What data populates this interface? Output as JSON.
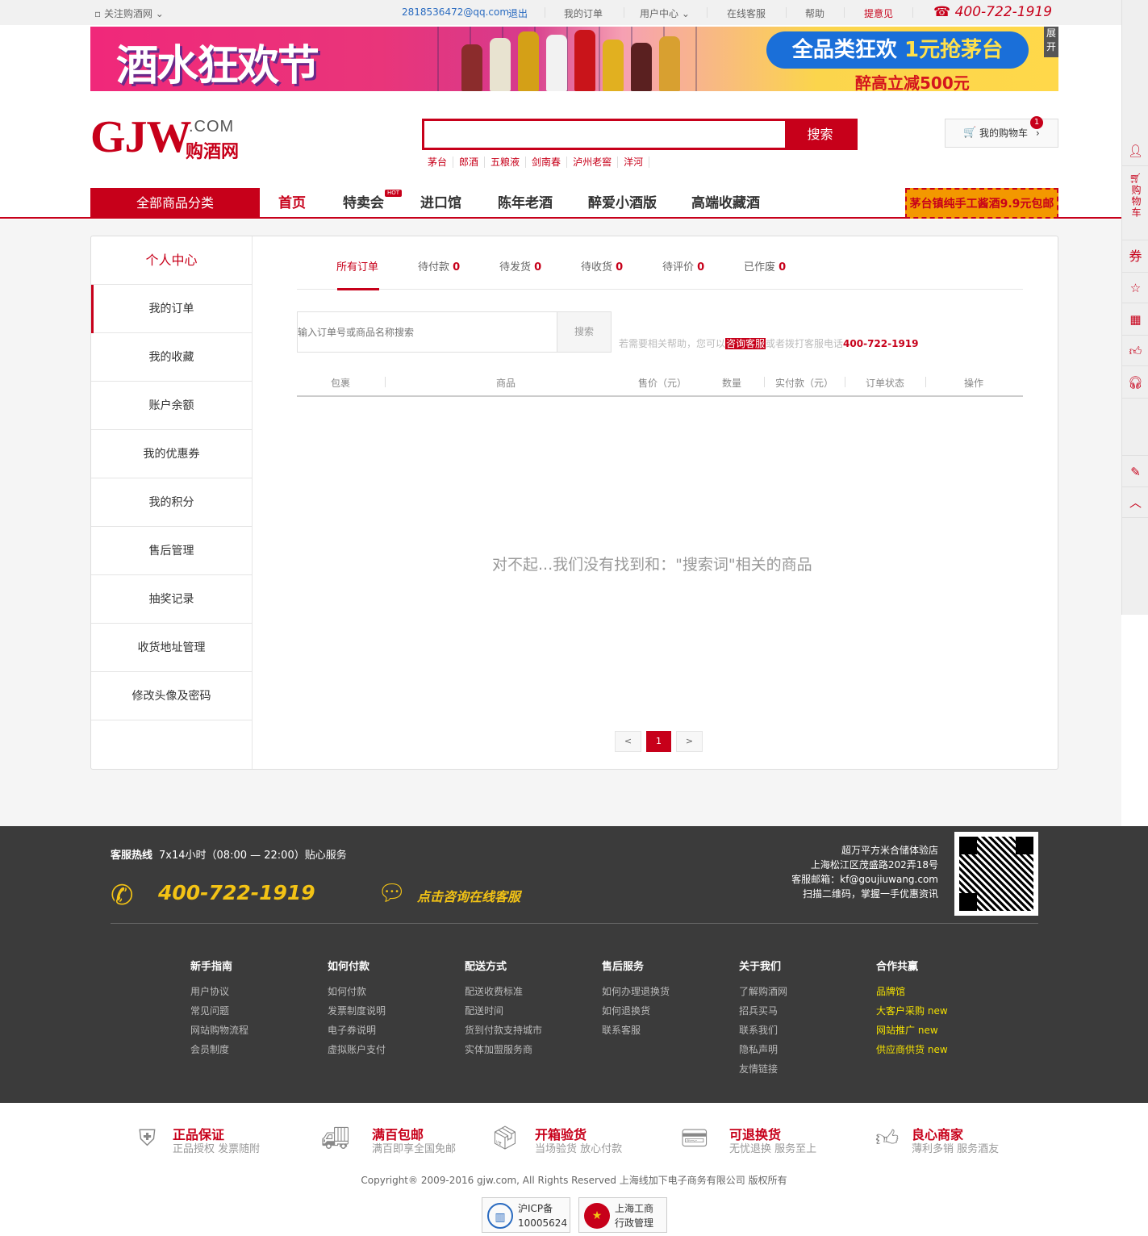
{
  "topbar": {
    "follow": "关注购酒网",
    "email": "2818536472@qq.com",
    "logout": "退出",
    "my_orders": "我的订单",
    "user_center": "用户中心",
    "online_service": "在线客服",
    "help": "帮助",
    "feedback": "提意见",
    "phone": "400-722-1919"
  },
  "banner": {
    "title": "酒水狂欢节",
    "pill": "全品类狂欢",
    "pill_highlight": "1元抢茅台",
    "sub": "醉高立减500元",
    "expand": "展开"
  },
  "logo": {
    "main": "GJW",
    "com": ".COM",
    "cn": "购酒网"
  },
  "search": {
    "placeholder": "",
    "button": "搜索",
    "hotwords": [
      "茅台",
      "郎酒",
      "五粮液",
      "剑南春",
      "泸州老窖",
      "洋河"
    ]
  },
  "cart": {
    "label": "我的购物车",
    "count": "1"
  },
  "nav": {
    "all": "全部商品分类",
    "links": [
      "首页",
      "特卖会",
      "进口馆",
      "陈年老酒",
      "醉爱小酒版",
      "高端收藏酒"
    ],
    "hot_badge": "HOT",
    "promo": "茅台镇纯手工酱酒9.9元包邮"
  },
  "sidebar": {
    "title": "个人中心",
    "items": [
      "我的订单",
      "我的收藏",
      "账户余额",
      "我的优惠券",
      "我的积分",
      "售后管理",
      "抽奖记录",
      "收货地址管理",
      "修改头像及密码"
    ]
  },
  "tabs": [
    {
      "label": "所有订单",
      "count": ""
    },
    {
      "label": "待付款",
      "count": "0"
    },
    {
      "label": "待发货",
      "count": "0"
    },
    {
      "label": "待收货",
      "count": "0"
    },
    {
      "label": "待评价",
      "count": "0"
    },
    {
      "label": "已作废",
      "count": "0"
    }
  ],
  "order_search": {
    "placeholder": "输入订单号或商品名称搜索",
    "button": "搜索"
  },
  "help_text": {
    "pre": "若需要相关帮助，您可以",
    "link": "咨询客服",
    "mid": "或者拨打客服电话",
    "tel": "400-722-1919"
  },
  "table_headers": [
    "包裹",
    "商品",
    "售价（元）",
    "数量",
    "实付款（元）",
    "订单状态",
    "操作"
  ],
  "empty_message": "对不起...我们没有找到和：\"搜索词\"相关的商品",
  "pager": {
    "prev": "<",
    "current": "1",
    "next": ">"
  },
  "right_bar": {
    "cart": "购物车",
    "coupon": "券"
  },
  "footer": {
    "hotline_label": "客服热线",
    "hotline_hours": "7x14小时（08:00 — 22:00）贴心服务",
    "phone": "400-722-1919",
    "online": "点击咨询在线客服",
    "addr": [
      "超万平方米合储体验店",
      "上海松江区茂盛路202弄18号",
      "客服邮箱：kf@goujiuwang.com",
      "扫描二维码，掌握一手优惠资讯"
    ],
    "columns": [
      {
        "title": "新手指南",
        "items": [
          "用户协议",
          "常见问题",
          "网站购物流程",
          "会员制度"
        ]
      },
      {
        "title": "如何付款",
        "items": [
          "如何付款",
          "发票制度说明",
          "电子券说明",
          "虚拟账户支付"
        ]
      },
      {
        "title": "配送方式",
        "items": [
          "配送收费标准",
          "配送时间",
          "货到付款支持城市",
          "实体加盟服务商"
        ]
      },
      {
        "title": "售后服务",
        "items": [
          "如何办理退换货",
          "如何退换货",
          "联系客服"
        ]
      },
      {
        "title": "关于我们",
        "items": [
          "了解购酒网",
          "招兵买马",
          "联系我们",
          "隐私声明",
          "友情链接"
        ]
      },
      {
        "title": "合作共赢",
        "items": [
          "品牌馆",
          "大客户采购",
          "网站推广",
          "供应商供货"
        ],
        "new_tag": "new"
      }
    ]
  },
  "guarantees": [
    {
      "title": "正品保证",
      "sub": "正品授权 发票随附"
    },
    {
      "title": "满百包邮",
      "sub": "满百即享全国免邮"
    },
    {
      "title": "开箱验货",
      "sub": "当场验货 放心付款"
    },
    {
      "title": "可退换货",
      "sub": "无忧退换 服务至上"
    },
    {
      "title": "良心商家",
      "sub": "薄利多销 服务酒友"
    }
  ],
  "copyright": "Copyright® 2009-2016 gjw.com, All Rights Reserved 上海线加下电子商务有限公司 版权所有",
  "certs": [
    {
      "line1": "沪ICP备",
      "line2": "10005624"
    },
    {
      "line1": "上海工商",
      "line2": "行政管理"
    }
  ]
}
